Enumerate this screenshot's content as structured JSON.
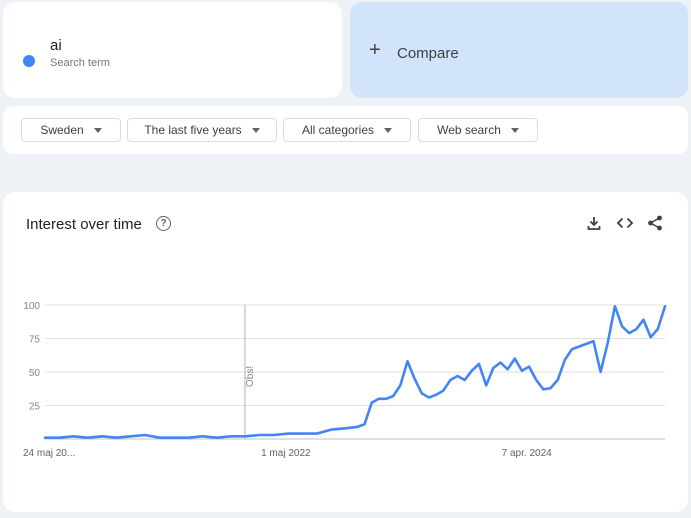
{
  "term": {
    "name": "ai",
    "subtitle": "Search term",
    "color": "#4285f4"
  },
  "compare": {
    "label": "Compare"
  },
  "filters": {
    "region": "Sweden",
    "time_range": "The last five years",
    "category": "All categories",
    "search_type": "Web search"
  },
  "chart": {
    "title": "Interest over time"
  },
  "colors": {
    "series": "#4285f4",
    "compare_bg": "#d2e3fc",
    "grid": "#e0e0e0",
    "page_bg": "#eef1f6"
  },
  "icons": [
    "help-icon",
    "download-icon",
    "embed-icon",
    "share-icon"
  ],
  "chart_data": {
    "type": "line",
    "title": "Interest over time",
    "xlabel": "",
    "ylabel": "",
    "ylim": [
      0,
      100
    ],
    "yticks": [
      25,
      50,
      75,
      100
    ],
    "grid": true,
    "x_tick_labels": [
      "24 maj 20...",
      "1 maj 2022",
      "7 apr. 2024"
    ],
    "annotation": {
      "label": "Obs!",
      "date": "2022-01-01"
    },
    "series": [
      {
        "x": [
          "2020-05-24",
          "2020-07-05",
          "2020-08-16",
          "2020-09-27",
          "2020-11-08",
          "2020-12-20",
          "2021-01-31",
          "2021-03-14",
          "2021-04-25",
          "2021-06-06",
          "2021-07-18",
          "2021-08-29",
          "2021-10-10",
          "2021-11-21",
          "2022-01-02",
          "2022-02-13",
          "2022-03-27",
          "2022-05-08",
          "2022-06-19",
          "2022-07-31",
          "2022-09-11",
          "2022-10-23",
          "2022-11-27",
          "2022-12-18",
          "2023-01-08",
          "2023-01-29",
          "2023-02-19",
          "2023-03-12",
          "2023-04-02",
          "2023-04-23",
          "2023-05-14",
          "2023-06-04",
          "2023-06-25",
          "2023-07-16",
          "2023-08-06",
          "2023-08-27",
          "2023-09-17",
          "2023-10-08",
          "2023-10-29",
          "2023-11-19",
          "2023-12-10",
          "2023-12-31",
          "2024-01-21",
          "2024-02-11",
          "2024-03-03",
          "2024-03-24",
          "2024-04-14",
          "2024-05-05",
          "2024-05-26",
          "2024-06-16",
          "2024-07-07",
          "2024-07-28",
          "2024-08-18",
          "2024-09-08",
          "2024-09-29",
          "2024-10-20",
          "2024-11-10",
          "2024-12-01",
          "2024-12-22",
          "2025-01-12",
          "2025-02-02",
          "2025-02-23",
          "2025-03-16",
          "2025-04-06",
          "2025-04-27",
          "2025-05-18"
        ],
        "y": [
          1,
          1,
          2,
          1,
          2,
          1,
          2,
          3,
          1,
          1,
          1,
          2,
          1,
          2,
          2,
          3,
          3,
          4,
          4,
          4,
          7,
          8,
          9,
          11,
          27,
          30,
          30,
          32,
          40,
          58,
          45,
          34,
          31,
          33,
          36,
          44,
          47,
          44,
          51,
          56,
          40,
          53,
          57,
          52,
          60,
          51,
          54,
          44,
          37,
          38,
          44,
          59,
          67,
          69,
          71,
          73,
          50,
          72,
          99,
          84,
          79,
          82,
          89,
          76,
          82,
          99
        ]
      }
    ]
  }
}
